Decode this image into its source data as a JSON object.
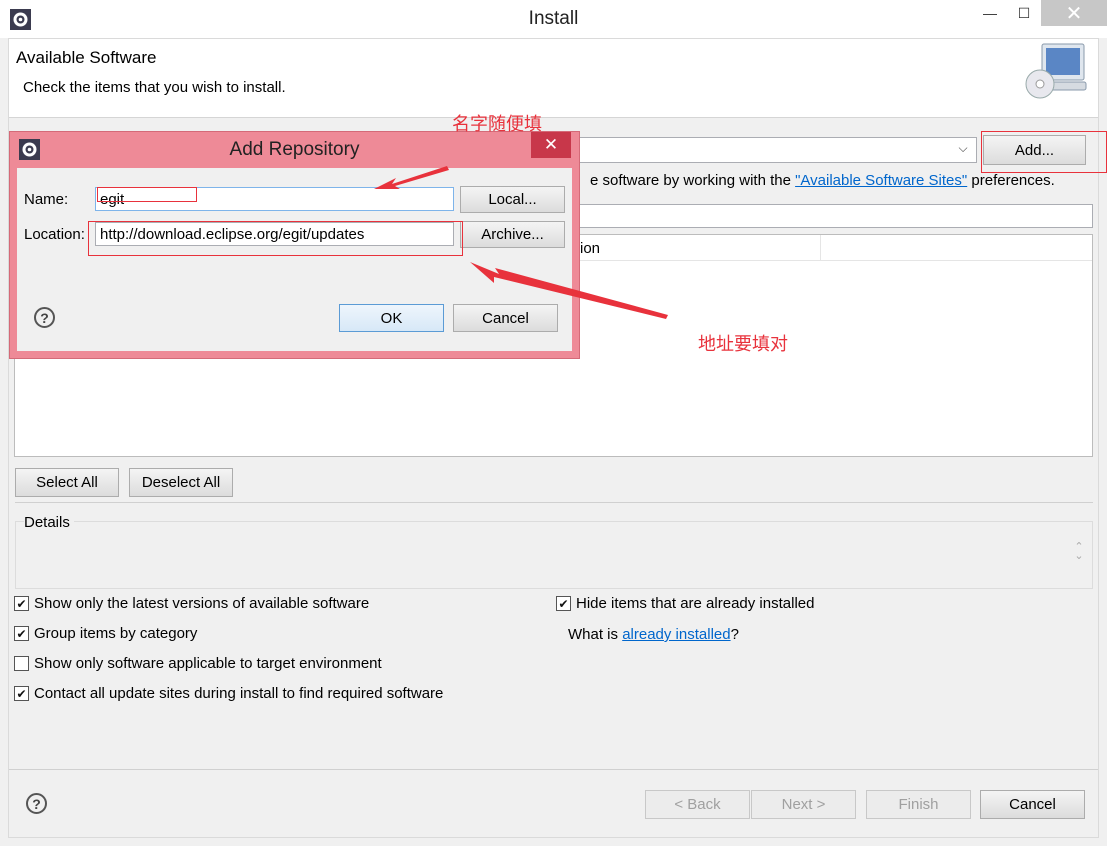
{
  "window": {
    "title": "Install",
    "minimize": "—",
    "maximize": "☐",
    "close": "✕"
  },
  "banner": {
    "title": "Available Software",
    "subtitle": "Check the items that you wish to install."
  },
  "work_with": {
    "add_label": "Add...",
    "sites_prefix": "e software by working with the ",
    "sites_link": "\"Available Software Sites\"",
    "sites_suffix": " preferences."
  },
  "table": {
    "visible_header_fragment": "ion"
  },
  "buttons": {
    "select_all": "Select All",
    "deselect_all": "Deselect All",
    "back": "< Back",
    "next": "Next >",
    "finish": "Finish",
    "cancel": "Cancel"
  },
  "details": {
    "label": "Details"
  },
  "options": {
    "latest_versions": {
      "label": "Show only the latest versions of available software",
      "checked": true
    },
    "group_by_category": {
      "label": "Group items by category",
      "checked": true
    },
    "target_environment": {
      "label": "Show only software applicable to target environment",
      "checked": false
    },
    "contact_all_sites": {
      "label": "Contact all update sites during install to find required software",
      "checked": true
    },
    "hide_installed": {
      "label": "Hide items that are already installed",
      "checked": true
    }
  },
  "installed": {
    "prefix": "What is ",
    "link": "already installed",
    "suffix": "?"
  },
  "dialog": {
    "title": "Add Repository",
    "close": "✕",
    "name_label": "Name:",
    "name_value": "egit",
    "location_label": "Location:",
    "location_value": "http://download.eclipse.org/egit/updates",
    "local_button": "Local...",
    "archive_button": "Archive...",
    "ok_button": "OK",
    "cancel_button": "Cancel"
  },
  "help_glyph": "?",
  "annotations": {
    "name_note": "名字随便填",
    "location_note": "地址要填对",
    "color": "#e8323c"
  }
}
